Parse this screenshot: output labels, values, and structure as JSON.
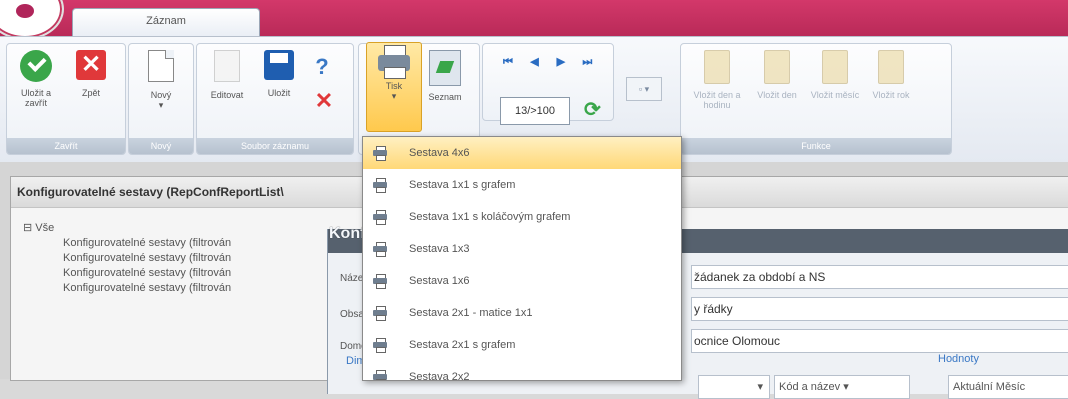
{
  "app": {
    "tab": "Záznam"
  },
  "ribbon": {
    "groups": {
      "zavrit": "Zavřít",
      "novy": "Nový",
      "soubory": "Soubor záznamu",
      "funkce": "Funkce"
    },
    "buttons": {
      "ulozit_zavrit": "Uložit a zavřít",
      "zpet": "Zpět",
      "novy": "Nový",
      "editovat": "Editovat",
      "ulozit": "Uložit",
      "tisk": "Tisk",
      "seznam": "Seznam",
      "vlozit_den_hodinu": "Vložit den a hodinu",
      "vlozit_den": "Vložit den",
      "vlozit_mesic": "Vložit měsíc",
      "vlozit_rok": "Vložit rok"
    },
    "nav": {
      "first": "⏮",
      "prev": "◀",
      "next": "▶",
      "last": "⏭",
      "counter": "13/>100"
    },
    "small_dropdown": "▫ ▾"
  },
  "panel": {
    "header": "Konfigurovatelné sestavy (RepConfReportList\\",
    "tree": {
      "root": "⊟ Vše",
      "items": [
        "Konfigurovatelné sestavy (filtrován",
        "Konfigurovatelné sestavy (filtrován",
        "Konfigurovatelné sestavy (filtrován",
        "Konfigurovatelné sestavy (filtrován"
      ]
    }
  },
  "dialog": {
    "title": "Konf",
    "labels": [
      "Název",
      "Obsah",
      "Domov"
    ],
    "fields": [
      "žádanek za období a NS",
      "y řádky",
      "ocnice Olomouc"
    ],
    "dim_label": "Dim",
    "hodnoty_label": "Hodnoty",
    "combo1": "▾",
    "combo2": "Kód a název ▾",
    "combo3": "Aktuální Měsíc"
  },
  "menu": {
    "items": [
      "Sestava 4x6",
      "Sestava 1x1 s grafem",
      "Sestava 1x1 s koláčovým grafem",
      "Sestava 1x3",
      "Sestava 1x6",
      "Sestava 2x1 - matice 1x1",
      "Sestava 2x1 s grafem",
      "Sestava 2x2"
    ]
  }
}
